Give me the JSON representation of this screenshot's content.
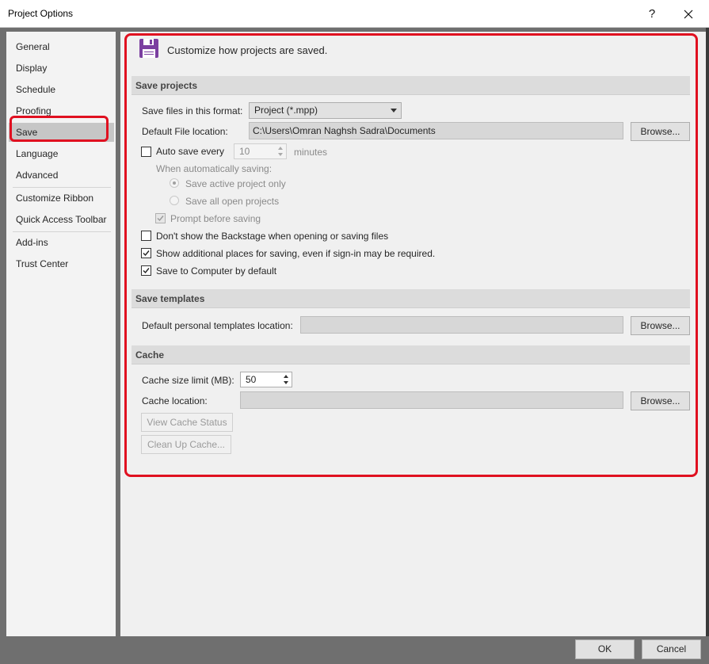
{
  "window": {
    "title": "Project Options",
    "help_label": "?"
  },
  "sidebar": {
    "items": [
      {
        "label": "General"
      },
      {
        "label": "Display"
      },
      {
        "label": "Schedule"
      },
      {
        "label": "Proofing"
      },
      {
        "label": "Save"
      },
      {
        "label": "Language"
      },
      {
        "label": "Advanced"
      },
      {
        "label": "Customize Ribbon"
      },
      {
        "label": "Quick Access Toolbar"
      },
      {
        "label": "Add-ins"
      },
      {
        "label": "Trust Center"
      }
    ],
    "selected": "Save"
  },
  "header": {
    "text": "Customize how projects are saved.",
    "icon": "floppy-disk-icon"
  },
  "save_projects": {
    "title": "Save projects",
    "format_label": "Save files in this format:",
    "format_value": "Project (*.mpp)",
    "location_label": "Default File location:",
    "location_value": "C:\\Users\\Omran Naghsh Sadra\\Documents",
    "browse_label": "Browse...",
    "autosave_label": "Auto save every",
    "autosave_value": "10",
    "autosave_unit": "minutes",
    "auto_saving_label": "When automatically saving:",
    "save_active_label": "Save active project only",
    "save_all_label": "Save all open projects",
    "prompt_label": "Prompt before saving",
    "backstage_label": "Don't show the Backstage when opening or saving files",
    "additional_places_label": "Show additional places for saving, even if sign-in may be required.",
    "save_computer_label": "Save to Computer by default"
  },
  "save_templates": {
    "title": "Save templates",
    "location_label": "Default personal templates location:",
    "location_value": "",
    "browse_label": "Browse..."
  },
  "cache": {
    "title": "Cache",
    "size_label": "Cache size limit (MB):",
    "size_value": "50",
    "location_label": "Cache location:",
    "location_value": "",
    "browse_label": "Browse...",
    "view_status_label": "View Cache Status",
    "clean_up_label": "Clean Up Cache..."
  },
  "footer": {
    "ok_label": "OK",
    "cancel_label": "Cancel"
  },
  "colors": {
    "highlight": "#e01020",
    "accent_icon": "#7b3fa0"
  }
}
